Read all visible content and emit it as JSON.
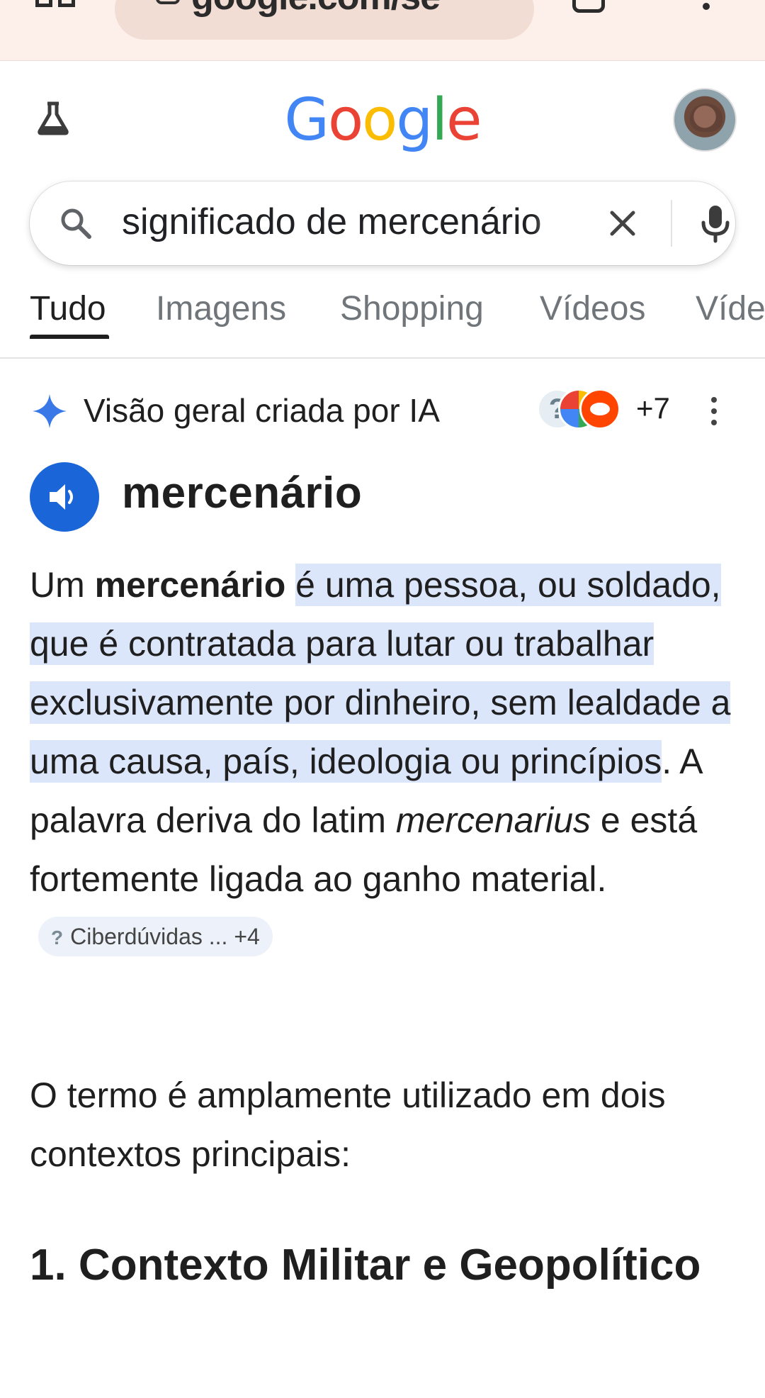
{
  "browser": {
    "url": "google.com/se"
  },
  "header": {
    "logo": [
      "G",
      "o",
      "o",
      "g",
      "l",
      "e"
    ],
    "logo_colors": [
      "#4285f4",
      "#ea4335",
      "#fbbc04",
      "#4285f4",
      "#34a853",
      "#ea4335"
    ]
  },
  "search": {
    "query": "significado de mercenário"
  },
  "tabs": [
    {
      "label": "Tudo"
    },
    {
      "label": "Imagens"
    },
    {
      "label": "Shopping"
    },
    {
      "label": "Vídeos"
    },
    {
      "label": "Víde"
    }
  ],
  "ai_overview": {
    "title": "Visão geral criada por IA",
    "sources_more": "+7",
    "term": "mercenário",
    "p1": {
      "a": "Um ",
      "b_bold": "mercenário",
      "c_space": " ",
      "d_highlight": "é uma pessoa, ou soldado, que é contratada para lutar ou trabalhar exclusivamente por dinheiro, sem lealdade a uma causa, país, ideologia ou princípios",
      "e": ". A palavra deriva do latim ",
      "f_italic": "mercenarius",
      "g": " e está fortemente ligada ao ganho material.",
      "chip_icon": "?",
      "chip_label": "Ciberdúvidas ... +4"
    },
    "p2": "O termo é amplamente utilizado em dois contextos principais:",
    "heading": "1. Contexto Militar e Geopolítico"
  },
  "colors": {
    "accent_blue": "#1a66d8",
    "highlight": "#dce6fb",
    "chrome_bg": "#fdf0ea"
  }
}
